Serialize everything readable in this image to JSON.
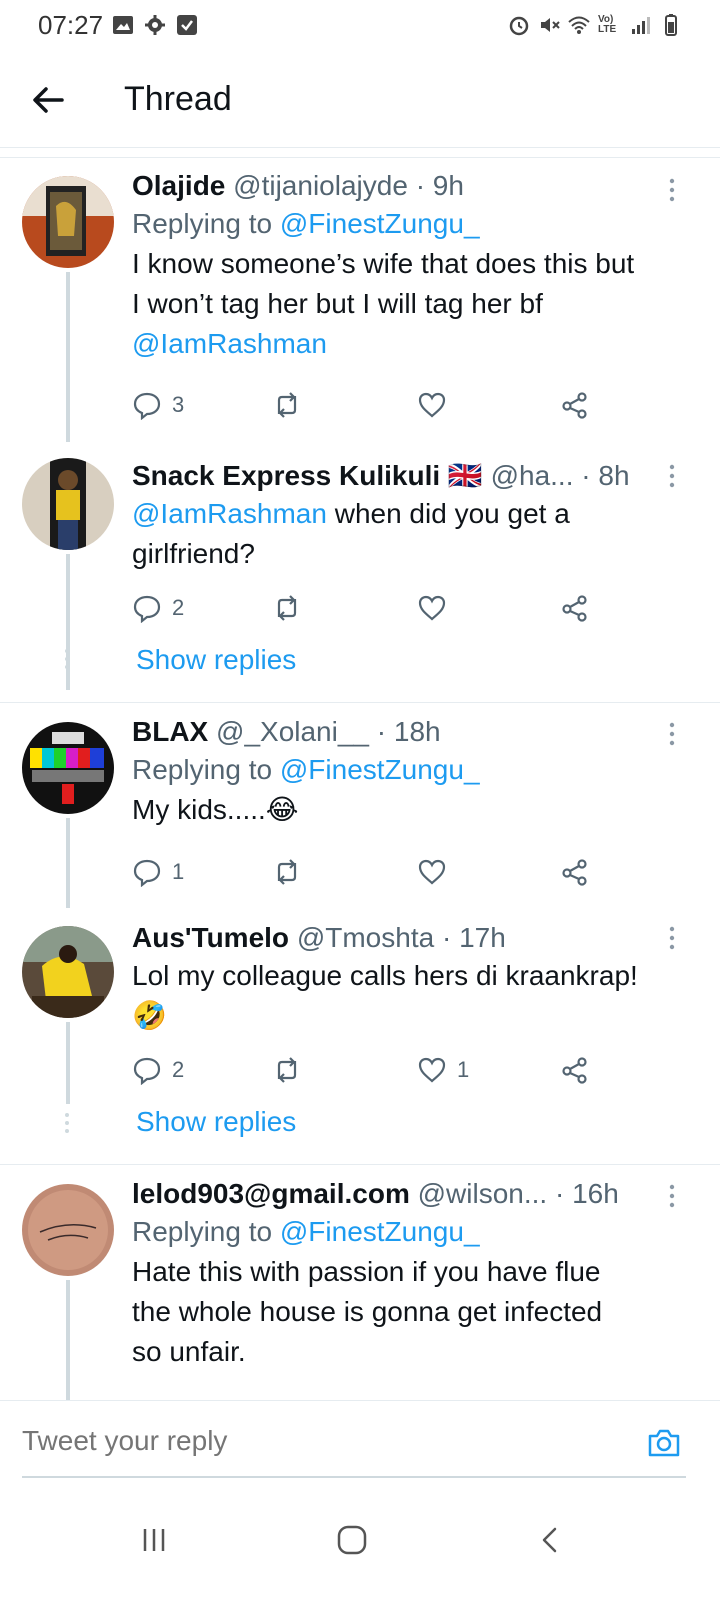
{
  "status_bar": {
    "time": "07:27",
    "left_icons": [
      "image-icon",
      "gear-icon",
      "check-box-icon"
    ],
    "right_icons": [
      "alarm-icon",
      "mute-icon",
      "wifi-icon",
      "volte-icon",
      "signal-icon",
      "battery-icon"
    ],
    "volte_label": "Vo) LTE"
  },
  "header": {
    "title": "Thread"
  },
  "tweets": [
    {
      "name": "Olajide",
      "handle": "@tijaniolajyde",
      "time": "· 9h",
      "replying_label": "Replying to",
      "replying_to": "@FinestZungu_",
      "text_lines": [
        "I know someone’s wife that does this but",
        "I won’t tag her but I will tag her bf"
      ],
      "mention": "@IamRashman",
      "replies": "3",
      "retweets": "",
      "likes": ""
    },
    {
      "name": "Snack Express Kulikuli",
      "flag": "🇬🇧",
      "handle": "@ha...",
      "time": "· 8h",
      "mention": "@IamRashman",
      "text_inline": " when did you get a",
      "text_line2": "girlfriend?",
      "replies": "2",
      "retweets": "",
      "likes": ""
    },
    {
      "name": "BLAX",
      "handle": "@_Xolani__",
      "time": "· 18h",
      "replying_label": "Replying to",
      "replying_to": "@FinestZungu_",
      "text": "My kids.....",
      "emoji": "😂",
      "replies": "1",
      "retweets": "",
      "likes": ""
    },
    {
      "name": "Aus'Tumelo",
      "handle": "@Tmoshta",
      "time": "· 17h",
      "text": "Lol my colleague calls hers di kraankrap!",
      "emoji": "🤣",
      "replies": "2",
      "retweets": "",
      "likes": "1"
    },
    {
      "name": "lelod903@gmail.com",
      "handle": "@wilson...",
      "time": "· 16h",
      "replying_label": "Replying to",
      "replying_to": "@FinestZungu_",
      "text_lines": [
        "Hate this with passion if you have flue",
        "the whole house is gonna get infected",
        "so unfair."
      ]
    }
  ],
  "show_replies_label": "Show replies",
  "composer": {
    "placeholder": "Tweet your reply"
  },
  "colors": {
    "link": "#1d9bf0",
    "muted": "#536471",
    "text": "#0f1419",
    "divider": "#e6ecf0"
  }
}
